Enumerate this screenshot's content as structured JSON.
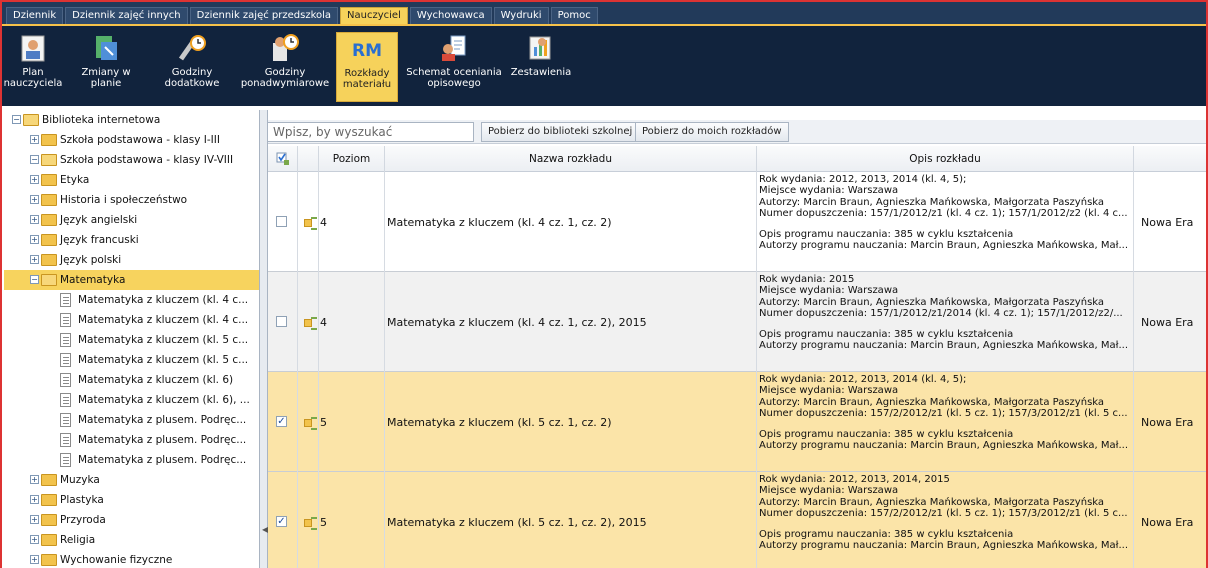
{
  "menubar": {
    "tabs": [
      {
        "label": "Dziennik"
      },
      {
        "label": "Dziennik zajęć innych"
      },
      {
        "label": "Dziennik zajęć przedszkola"
      },
      {
        "label": "Nauczyciel"
      },
      {
        "label": "Wychowawca"
      },
      {
        "label": "Wydruki"
      },
      {
        "label": "Pomoc"
      }
    ],
    "active_tab": "Nauczyciel"
  },
  "ribbon": {
    "buttons": [
      {
        "label": "Plan\nnauczyciela",
        "icon": "teacher-plan-icon"
      },
      {
        "label": "Zmiany w\nplanie",
        "icon": "plan-changes-icon"
      },
      {
        "label": "Godziny\ndodatkowe",
        "icon": "extra-hours-icon"
      },
      {
        "label": "Godziny\nponadwymiarowe",
        "icon": "overtime-hours-icon"
      },
      {
        "label": "Rozkłady\nmateriału",
        "icon": "rm-icon",
        "icon_text": "RM"
      },
      {
        "label": "Schemat oceniania\nopisowego",
        "icon": "grading-scheme-icon"
      },
      {
        "label": "Zestawienia",
        "icon": "reports-icon"
      }
    ],
    "active": "Rozkłady materiału"
  },
  "tree": {
    "nodes": [
      {
        "label": "Biblioteka internetowa",
        "level": 0,
        "type": "folder",
        "expanded": true
      },
      {
        "label": "Szkoła podstawowa - klasy I-III",
        "level": 1,
        "type": "folder",
        "expanded": false
      },
      {
        "label": "Szkoła podstawowa - klasy IV-VIII",
        "level": 1,
        "type": "folder",
        "expanded": true
      },
      {
        "label": "Etyka",
        "level": 2,
        "type": "folder",
        "expanded": false
      },
      {
        "label": "Historia i społeczeństwo",
        "level": 2,
        "type": "folder",
        "expanded": false
      },
      {
        "label": "Język angielski",
        "level": 2,
        "type": "folder",
        "expanded": false
      },
      {
        "label": "Język francuski",
        "level": 2,
        "type": "folder",
        "expanded": false
      },
      {
        "label": "Język polski",
        "level": 2,
        "type": "folder",
        "expanded": false
      },
      {
        "label": "Matematyka",
        "level": 2,
        "type": "folder",
        "expanded": true,
        "selected": true
      },
      {
        "label": "Matematyka z kluczem (kl. 4 c...",
        "level": 3,
        "type": "doc"
      },
      {
        "label": "Matematyka z kluczem (kl. 4 c...",
        "level": 3,
        "type": "doc"
      },
      {
        "label": "Matematyka z kluczem (kl. 5 c...",
        "level": 3,
        "type": "doc"
      },
      {
        "label": "Matematyka z kluczem (kl. 5 c...",
        "level": 3,
        "type": "doc"
      },
      {
        "label": "Matematyka z kluczem (kl. 6)",
        "level": 3,
        "type": "doc"
      },
      {
        "label": "Matematyka z kluczem (kl. 6), ...",
        "level": 3,
        "type": "doc"
      },
      {
        "label": "Matematyka z plusem. Podręc...",
        "level": 3,
        "type": "doc"
      },
      {
        "label": "Matematyka z plusem. Podręc...",
        "level": 3,
        "type": "doc"
      },
      {
        "label": "Matematyka z plusem. Podręc...",
        "level": 3,
        "type": "doc"
      },
      {
        "label": "Muzyka",
        "level": 2,
        "type": "folder",
        "expanded": false
      },
      {
        "label": "Plastyka",
        "level": 2,
        "type": "folder",
        "expanded": false
      },
      {
        "label": "Przyroda",
        "level": 2,
        "type": "folder",
        "expanded": false
      },
      {
        "label": "Religia",
        "level": 2,
        "type": "folder",
        "expanded": false
      },
      {
        "label": "Wychowanie fizyczne",
        "level": 2,
        "type": "folder",
        "expanded": false
      }
    ]
  },
  "toolbar": {
    "search_placeholder": "Wpisz, by wyszukać",
    "btn_school_library": "Pobierz do biblioteki szkolnej",
    "btn_my_schedules": "Pobierz do moich rozkładów"
  },
  "grid": {
    "headers": {
      "poziom": "Poziom",
      "nazwa": "Nazwa rozkładu",
      "opis": "Opis rozkładu"
    },
    "rows": [
      {
        "checked": false,
        "poziom": "4",
        "nazwa": "Matematyka z kluczem (kl. 4 cz. 1, cz. 2)",
        "opis": [
          "Rok wydania: 2012, 2013, 2014 (kl. 4, 5);",
          "Miejsce wydania: Warszawa",
          "Autorzy: Marcin Braun, Agnieszka Mańkowska, Małgorzata Paszyńska",
          "Numer dopuszczenia: 157/1/2012/z1 (kl. 4 cz. 1); 157/1/2012/z2 (kl. 4 c...",
          "",
          "Opis programu nauczania: 385 w cyklu kształcenia",
          "Autorzy programu nauczania: Marcin Braun, Agnieszka Mańkowska, Mał..."
        ],
        "wydawnictwo": "Nowa Era"
      },
      {
        "checked": false,
        "poziom": "4",
        "nazwa": "Matematyka z kluczem (kl. 4 cz. 1, cz. 2), 2015",
        "opis": [
          "Rok wydania: 2015",
          "Miejsce wydania: Warszawa",
          "Autorzy: Marcin Braun, Agnieszka Mańkowska, Małgorzata Paszyńska",
          "Numer dopuszczenia: 157/1/2012/z1/2014 (kl. 4 cz. 1); 157/1/2012/z2/...",
          "",
          "Opis programu nauczania: 385 w cyklu kształcenia",
          "Autorzy programu nauczania: Marcin Braun, Agnieszka Mańkowska, Mał..."
        ],
        "wydawnictwo": "Nowa Era"
      },
      {
        "checked": true,
        "poziom": "5",
        "nazwa": "Matematyka z kluczem (kl. 5 cz. 1, cz. 2)",
        "opis": [
          "Rok wydania: 2012, 2013, 2014 (kl. 4, 5);",
          "Miejsce wydania: Warszawa",
          "Autorzy: Marcin Braun, Agnieszka Mańkowska, Małgorzata Paszyńska",
          "Numer dopuszczenia: 157/2/2012/z1 (kl. 5 cz. 1); 157/3/2012/z1 (kl. 5 c...",
          "",
          "Opis programu nauczania: 385 w cyklu kształcenia",
          "Autorzy programu nauczania: Marcin Braun, Agnieszka Mańkowska, Mał..."
        ],
        "wydawnictwo": "Nowa Era"
      },
      {
        "checked": true,
        "poziom": "5",
        "nazwa": "Matematyka z kluczem (kl. 5 cz. 1, cz. 2), 2015",
        "opis": [
          "Rok wydania: 2012, 2013, 2014, 2015",
          "Miejsce wydania: Warszawa",
          "Autorzy: Marcin Braun, Agnieszka Mańkowska, Małgorzata Paszyńska",
          "Numer dopuszczenia: 157/2/2012/z1 (kl. 5 cz. 1); 157/3/2012/z1 (kl. 5 c...",
          "",
          "Opis programu nauczania: 385 w cyklu kształcenia",
          "Autorzy programu nauczania: Marcin Braun, Agnieszka Mańkowska, Mał..."
        ],
        "wydawnictwo": "Nowa Era"
      }
    ]
  },
  "colors": {
    "menubar_bg": "#223a5a",
    "ribbon_bg": "#11233d",
    "accent_yellow": "#f6d25b",
    "selected_row": "#fbe4a8",
    "frame_border": "#dd3333"
  }
}
